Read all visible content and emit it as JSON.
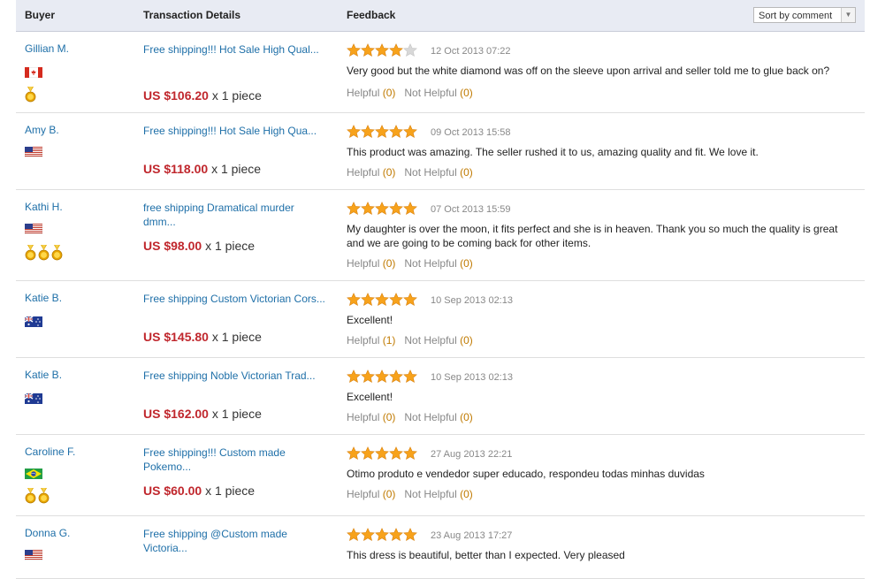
{
  "header": {
    "buyer": "Buyer",
    "transaction": "Transaction Details",
    "feedback": "Feedback",
    "sort_value": "Sort by comment"
  },
  "labels": {
    "helpful": "Helpful",
    "not_helpful": "Not Helpful",
    "qty_suffix": "x 1 piece"
  },
  "reviews": [
    {
      "buyer": "Gillian M.",
      "flag": "canada",
      "medals": 1,
      "title": "Free shipping!!! Hot Sale High Qual...",
      "price": "US $106.20",
      "rating": 4,
      "date": "12 Oct 2013 07:22",
      "comment": "Very good but the white diamond was off on the sleeve upon arrival and seller told me to glue back on?",
      "helpful": "(0)",
      "not_helpful": "(0)"
    },
    {
      "buyer": "Amy B.",
      "flag": "usa",
      "medals": 0,
      "title": "Free shipping!!! Hot Sale High Qua...",
      "price": "US $118.00",
      "rating": 5,
      "date": "09 Oct 2013 15:58",
      "comment": "This product was amazing. The seller rushed it to us, amazing quality and fit. We love it.",
      "helpful": "(0)",
      "not_helpful": "(0)"
    },
    {
      "buyer": "Kathi H.",
      "flag": "usa",
      "medals": 3,
      "title": "free shipping Dramatical murder dmm...",
      "price": "US $98.00",
      "rating": 5,
      "date": "07 Oct 2013 15:59",
      "comment": "My daughter is over the moon, it fits perfect and she is in heaven. Thank you so much the quality is great and we are going to be coming back for other items.",
      "helpful": "(0)",
      "not_helpful": "(0)"
    },
    {
      "buyer": "Katie B.",
      "flag": "australia",
      "medals": 0,
      "title": "Free shipping Custom Victorian Cors...",
      "price": "US $145.80",
      "rating": 5,
      "date": "10 Sep 2013 02:13",
      "comment": "Excellent!",
      "helpful": "(1)",
      "not_helpful": "(0)"
    },
    {
      "buyer": "Katie B.",
      "flag": "australia",
      "medals": 0,
      "title": "Free shipping Noble Victorian Trad...",
      "price": "US $162.00",
      "rating": 5,
      "date": "10 Sep 2013 02:13",
      "comment": "Excellent!",
      "helpful": "(0)",
      "not_helpful": "(0)"
    },
    {
      "buyer": "Caroline F.",
      "flag": "brazil",
      "medals": 2,
      "title": "Free shipping!!! Custom made Pokemo...",
      "price": "US $60.00",
      "rating": 5,
      "date": "27 Aug 2013 22:21",
      "comment": "Otimo produto e vendedor super educado, respondeu todas minhas duvidas",
      "helpful": "(0)",
      "not_helpful": "(0)"
    },
    {
      "buyer": "Donna G.",
      "flag": "usa",
      "medals": 0,
      "title": "Free shipping @Custom made Victoria...",
      "price": "",
      "rating": 5,
      "date": "23 Aug 2013 17:27",
      "comment": "This dress is beautiful, better than I expected. Very pleased",
      "helpful": "",
      "not_helpful": ""
    }
  ],
  "colors": {
    "link": "#1e6fa8",
    "price": "#c0272d",
    "star": "#f7a21b",
    "count": "#c07a00"
  }
}
